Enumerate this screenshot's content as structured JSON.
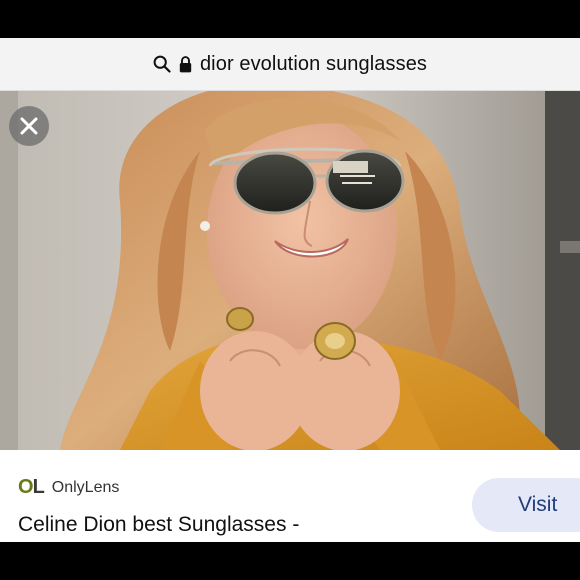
{
  "browser": {
    "search_query": "dior evolution sunglasses",
    "search_icon": "search-icon",
    "lock_icon": "lock-icon"
  },
  "viewer": {
    "close_icon": "close-icon",
    "image_alt": "Woman with wavy blonde hair wearing round metal-frame sunglasses, mustard leather jacket and gold rings, hands under chin"
  },
  "result": {
    "source_logo_o": "O",
    "source_logo_l": "L",
    "source_name": "OnlyLens",
    "caption": "Celine Dion best Sunglasses -",
    "visit_label": "Visit"
  },
  "colors": {
    "accent_visit_bg": "#e5e8f6",
    "accent_visit_text": "#1f3c7b",
    "logo_olive": "#6b7a17"
  }
}
